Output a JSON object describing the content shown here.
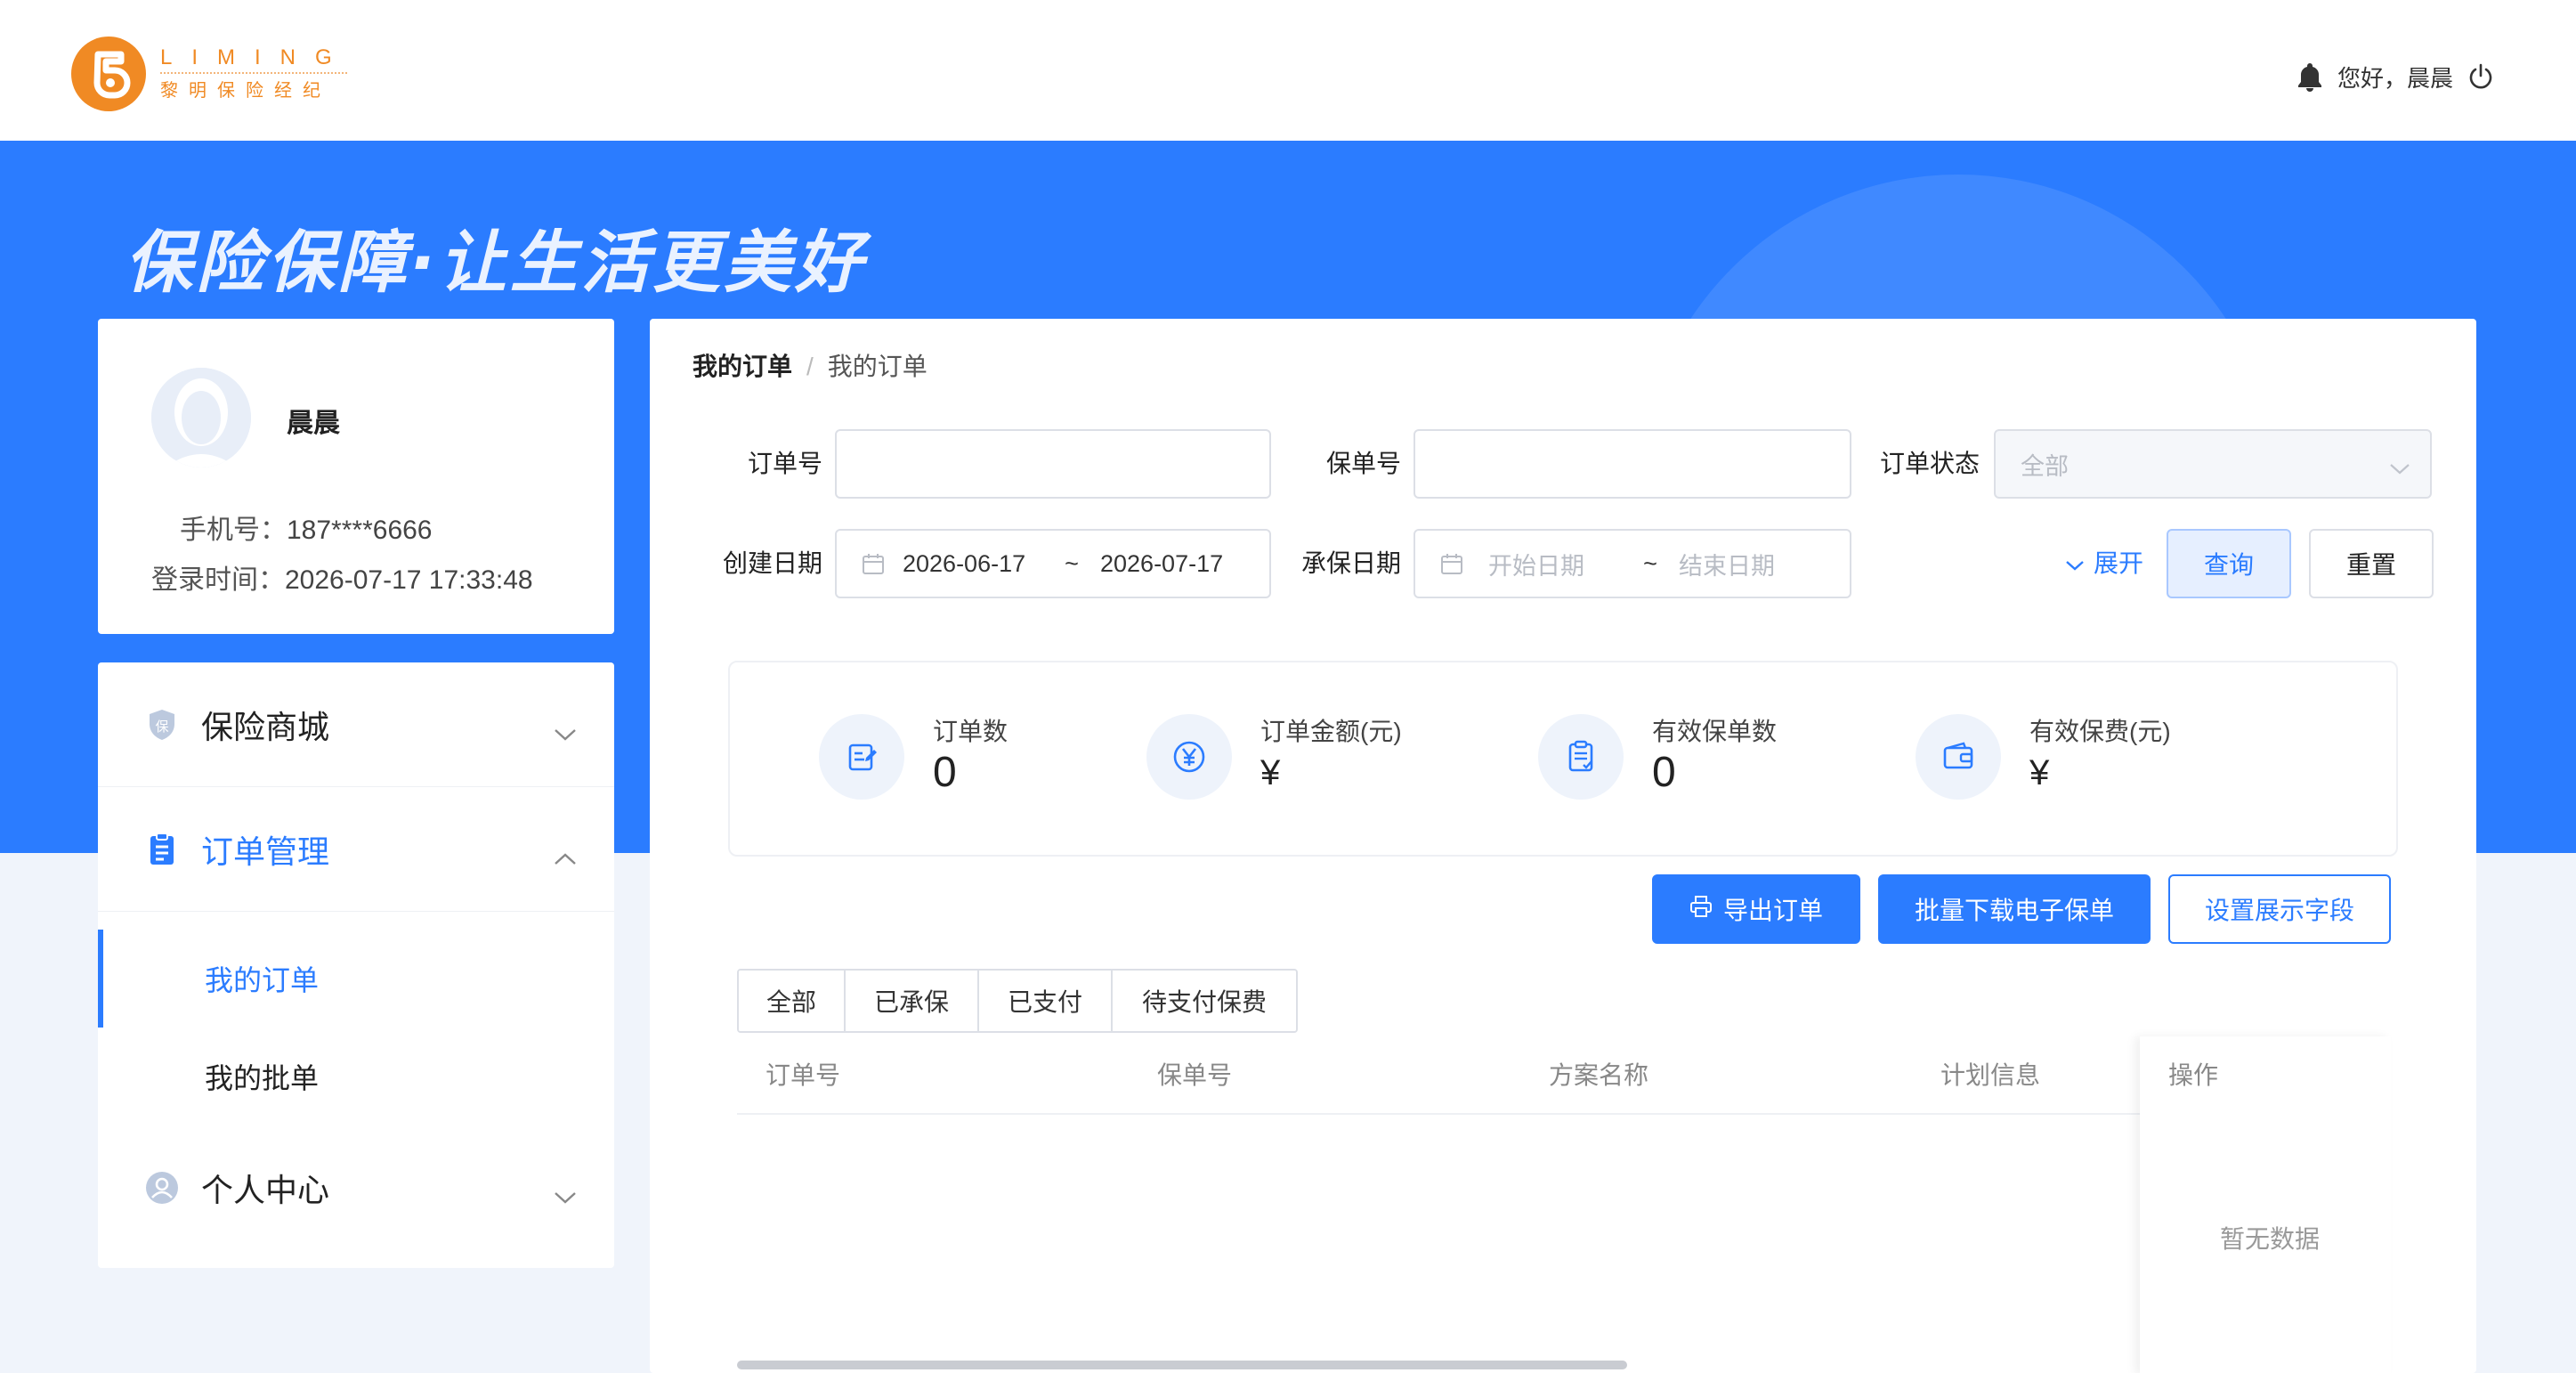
{
  "header": {
    "logo_en": "LIMING",
    "logo_cn": "黎明保险经纪",
    "greeting": "您好，晨晨"
  },
  "banner": {
    "slogan": "保险保障·让生活更美好"
  },
  "profile": {
    "name": "晨晨",
    "phone_label": "手机号：",
    "phone": "187****6666",
    "login_label": "登录时间：",
    "login_time": "2026-07-17 17:33:48"
  },
  "menu": {
    "items": [
      {
        "label": "保险商城",
        "icon": "shield-icon",
        "expanded": false
      },
      {
        "label": "订单管理",
        "icon": "clipboard-icon",
        "expanded": true
      },
      {
        "label": "个人中心",
        "icon": "user-icon",
        "expanded": false
      }
    ],
    "sub_items": [
      {
        "label": "我的订单",
        "active": true
      },
      {
        "label": "我的批单",
        "active": false
      }
    ]
  },
  "breadcrumb": {
    "root": "我的订单",
    "sep": "/",
    "current": "我的订单"
  },
  "filters": {
    "order_no_label": "订单号",
    "order_no_value": "",
    "policy_no_label": "保单号",
    "policy_no_value": "",
    "status_label": "订单状态",
    "status_value": "全部",
    "create_date_label": "创建日期",
    "create_start": "2026-06-17",
    "create_end": "2026-07-17",
    "tilde": "~",
    "underwrite_date_label": "承保日期",
    "underwrite_start_placeholder": "开始日期",
    "underwrite_end_placeholder": "结束日期",
    "expand_label": "展开",
    "query_label": "查询",
    "reset_label": "重置"
  },
  "stats": [
    {
      "label": "订单数",
      "value": "0",
      "icon": "order-edit-icon"
    },
    {
      "label": "订单金额(元)",
      "value": "¥",
      "icon": "yuan-icon"
    },
    {
      "label": "有效保单数",
      "value": "0",
      "icon": "policy-doc-icon"
    },
    {
      "label": "有效保费(元)",
      "value": "¥",
      "icon": "wallet-icon"
    }
  ],
  "actions": {
    "export_label": "导出订单",
    "batch_download_label": "批量下载电子保单",
    "settings_label": "设置展示字段"
  },
  "tabs": [
    "全部",
    "已承保",
    "已支付",
    "待支付保费"
  ],
  "table": {
    "columns": [
      "订单号",
      "保单号",
      "方案名称",
      "计划信息",
      "操作"
    ],
    "empty_text": "暂无数据"
  },
  "colors": {
    "primary": "#2b7cff",
    "brand_orange": "#f08a24"
  }
}
